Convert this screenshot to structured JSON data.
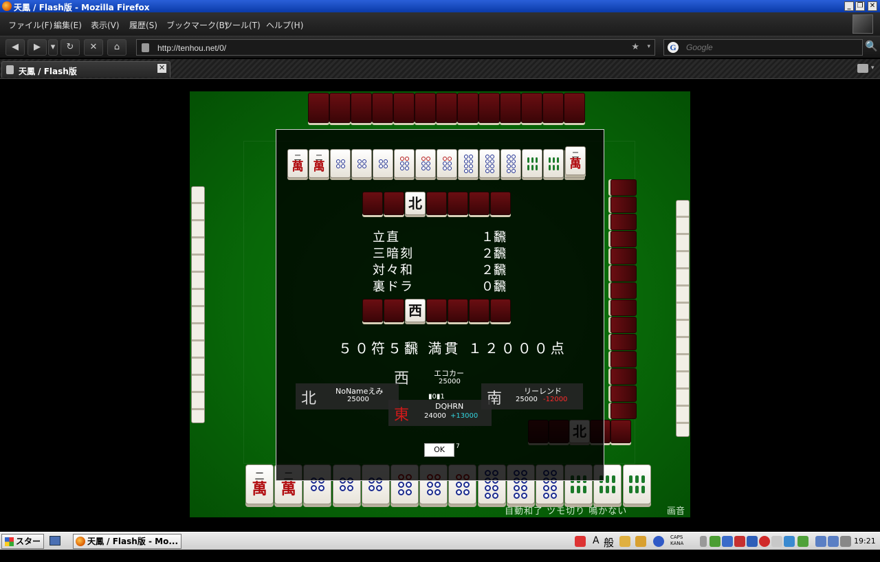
{
  "window": {
    "title": "天鳳 / Flash版 - Mozilla Firefox",
    "min": "_",
    "max": "❐",
    "close": "✕"
  },
  "menu": [
    "ファイル(F)",
    "編集(E)",
    "表示(V)",
    "履歴(S)",
    "ブックマーク(B)",
    "ツール(T)",
    "ヘルプ(H)"
  ],
  "nav": {
    "back": "◀",
    "forward": "▶",
    "dropdown": "▾",
    "reload": "↻",
    "stop": "✕",
    "home": "⌂",
    "url": "http://tenhou.net/0/",
    "bookmark_star": "★",
    "url_dropdown": "▾",
    "search_engine": "G",
    "search_placeholder": "Google",
    "search_go": "🔍"
  },
  "tab": {
    "label": "天鳳 / Flash版",
    "close": "✕",
    "list_arrow": "▾"
  },
  "game": {
    "status_options": "自動和了  ツモ切り  鳴かない",
    "sound": "画音",
    "player_hand": [
      {
        "suit": "man",
        "num": "二",
        "char": "萬"
      },
      {
        "suit": "man",
        "num": "二",
        "char": "萬"
      },
      {
        "suit": "pin",
        "count": 4
      },
      {
        "suit": "pin",
        "count": 4
      },
      {
        "suit": "pin",
        "count": 4
      },
      {
        "suit": "pin",
        "count": 6
      },
      {
        "suit": "pin",
        "count": 6
      },
      {
        "suit": "pin",
        "count": 6
      },
      {
        "suit": "pin",
        "count": 8
      },
      {
        "suit": "pin",
        "count": 8
      },
      {
        "suit": "pin",
        "count": 8
      },
      {
        "suit": "sou",
        "count": 6
      },
      {
        "suit": "sou",
        "count": 6
      },
      {
        "suit": "sou",
        "count": 6
      }
    ],
    "right_meld_tile": "北"
  },
  "result": {
    "winning_hand": [
      {
        "suit": "man",
        "num": "二",
        "char": "萬"
      },
      {
        "suit": "man",
        "num": "二",
        "char": "萬"
      },
      {
        "suit": "pin",
        "count": 4
      },
      {
        "suit": "pin",
        "count": 4
      },
      {
        "suit": "pin",
        "count": 4
      },
      {
        "suit": "pin",
        "count": 6
      },
      {
        "suit": "pin",
        "count": 6
      },
      {
        "suit": "pin",
        "count": 6
      },
      {
        "suit": "pin",
        "count": 8
      },
      {
        "suit": "pin",
        "count": 8
      },
      {
        "suit": "pin",
        "count": 8
      },
      {
        "suit": "sou",
        "count": 6
      },
      {
        "suit": "sou",
        "count": 6
      },
      {
        "suit": "sou",
        "count": 6
      }
    ],
    "winning_tile": {
      "suit": "man",
      "num": "二",
      "char": "萬"
    },
    "dora_indicator": "北",
    "uradora_indicator": "西",
    "yaku": [
      {
        "name": "立直",
        "han": "１飜"
      },
      {
        "name": "三暗刻",
        "han": "２飜"
      },
      {
        "name": "対々和",
        "han": "２飜"
      },
      {
        "name": "裏ドラ",
        "han": "０飜"
      }
    ],
    "total": "５０符５飜  満貫  １２０００点",
    "players": {
      "west": {
        "wind": "西",
        "name": "エコカー",
        "score": "25000"
      },
      "north": {
        "wind": "北",
        "name": "NoNameえみ",
        "score": "25000"
      },
      "south": {
        "wind": "南",
        "name": "リーレンド",
        "score": "25000",
        "delta": "-12000",
        "delta_color": "#ff2a2a"
      },
      "east": {
        "wind": "東",
        "name": "DQHRN",
        "score": "24000",
        "delta": "+13000",
        "delta_color": "#33d6e0"
      }
    },
    "counters": "▮0▮1",
    "ok_label": "OK",
    "countdown": "7"
  },
  "taskbar": {
    "start": "スタート",
    "task_label": "天鳳 / Flash版 - Mo...",
    "ime_a": "A",
    "ime_mode": "般",
    "caps": "CAPS\nKANA",
    "clock": "19:21"
  }
}
